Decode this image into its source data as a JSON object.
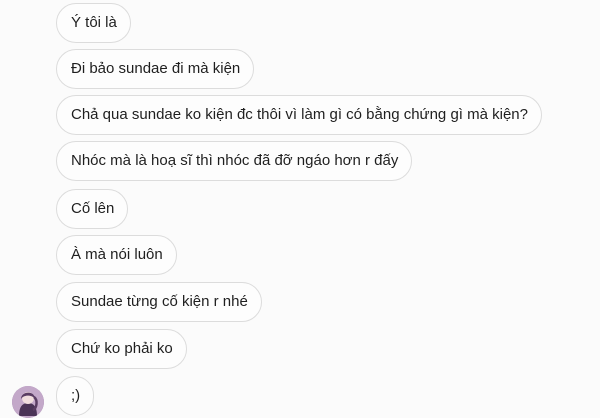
{
  "conversation": {
    "messages": [
      "Ý tôi là",
      "Đi bảo sundae đi mà kiện",
      "Chả qua sundae ko kiện đc thôi vì làm gì có bằng chứng gì mà kiện?",
      "Nhóc mà là hoạ sĩ thì nhóc đã đỡ ngáo hơn r đấy",
      "Cố lên",
      "À mà nói luôn",
      "Sundae từng cố kiện r nhé",
      "Chứ ko phải ko",
      ";)"
    ]
  },
  "icons": {
    "sender_avatar": "user-avatar-icon"
  }
}
